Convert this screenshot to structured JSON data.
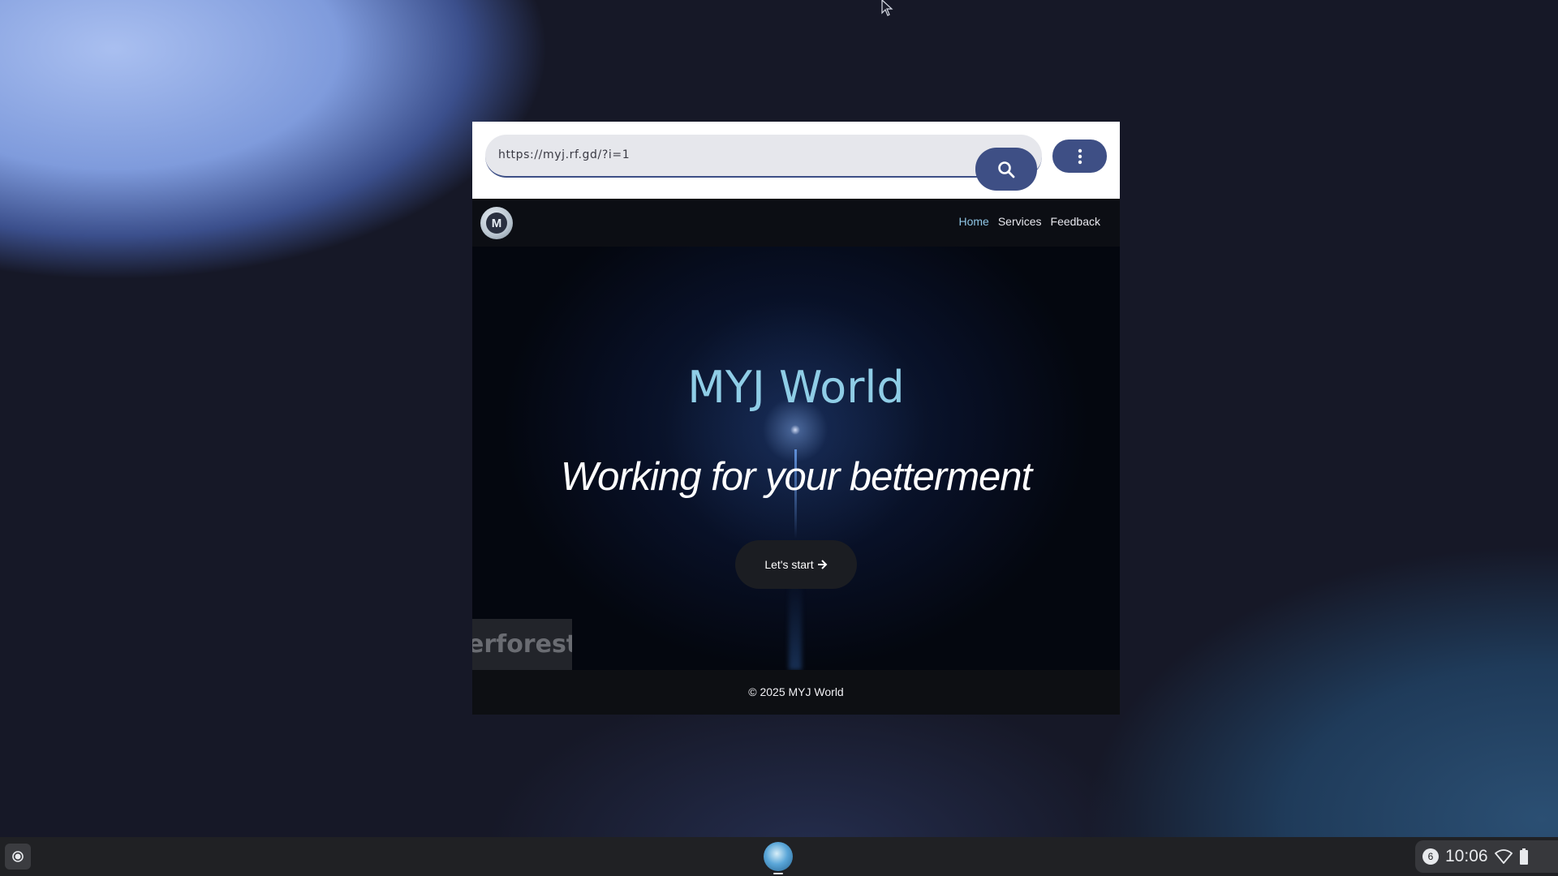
{
  "browser": {
    "url": "https://myj.rf.gd/?i=1",
    "search_button_icon": "search-icon",
    "menu_button_icon": "more-vert-icon"
  },
  "site": {
    "logo_letter": "M",
    "nav": [
      {
        "label": "Home",
        "active": true
      },
      {
        "label": "Services",
        "active": false
      },
      {
        "label": "Feedback",
        "active": false
      }
    ],
    "hero": {
      "title": "MYJ World",
      "subtitle": "Working for your betterment",
      "cta_label": "Let's start",
      "cta_icon": "arrow-right-icon"
    },
    "watermark": "erforest",
    "footer": "© 2025 MYJ World"
  },
  "shelf": {
    "notification_count": "6",
    "time": "10:06"
  },
  "colors": {
    "accent": "#3e4f85",
    "title": "#8fcde6",
    "active_nav": "#8fc6e6"
  }
}
